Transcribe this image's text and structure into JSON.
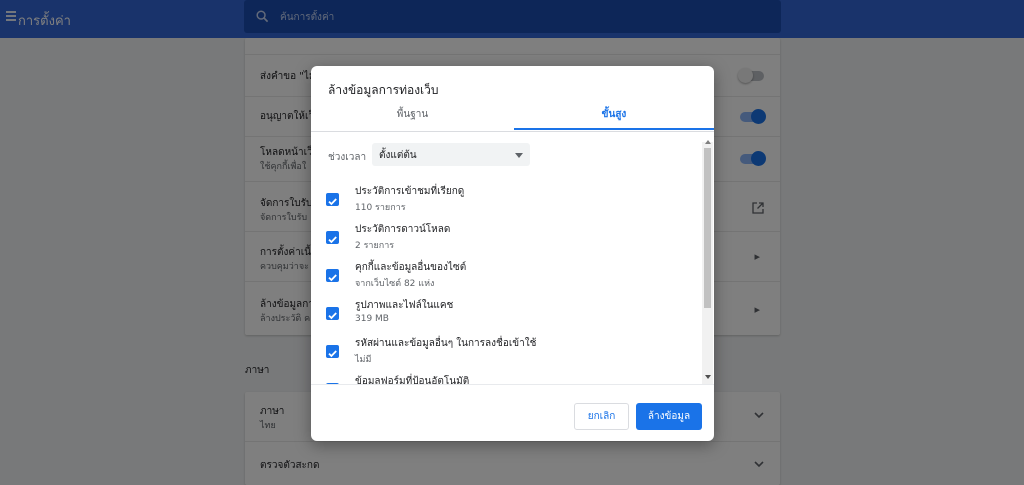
{
  "header": {
    "title": "การตั้งค่า",
    "search_placeholder": "ค้นการตั้งค่า"
  },
  "background": {
    "rows": [
      {
        "title": "ส่งคำขอ \"ไม่",
        "toggle": "off"
      },
      {
        "title": "อนุญาตให้เว็",
        "toggle": "on"
      },
      {
        "title": "โหลดหน้าเว็",
        "subtitle": "ใช้คุกกี้เพื่อใ",
        "toggle": "on"
      },
      {
        "title": "จัดการใบรับ",
        "subtitle": "จัดการใบรับ"
      },
      {
        "title": "การตั้งค่าเนื้",
        "subtitle": "ควบคุมว่าจะ"
      },
      {
        "title": "ล้างข้อมูลกา",
        "subtitle": "ล้างประวัติ ค"
      }
    ],
    "language_section": {
      "heading": "ภาษา",
      "rows": [
        {
          "title": "ภาษา",
          "subtitle": "ไทย"
        },
        {
          "title": "ตรวจตัวสะกด"
        }
      ]
    }
  },
  "dialog": {
    "title": "ล้างข้อมูลการท่องเว็บ",
    "tabs": {
      "basic": "พื้นฐาน",
      "advanced": "ขั้นสูง",
      "active": "advanced"
    },
    "time_range": {
      "label": "ช่วงเวลา",
      "value": "ตั้งแต่ต้น"
    },
    "items": [
      {
        "title": "ประวัติการเข้าชมที่เรียกดู",
        "subtitle": "110 รายการ",
        "checked": true
      },
      {
        "title": "ประวัติการดาวน์โหลด",
        "subtitle": "2 รายการ",
        "checked": true
      },
      {
        "title": "คุกกี้และข้อมูลอื่นของไซต์",
        "subtitle": "จากเว็บไซต์ 82 แห่ง",
        "checked": true
      },
      {
        "title": "รูปภาพและไฟล์ในแคช",
        "subtitle": "319 MB",
        "checked": true
      },
      {
        "title": "รหัสผ่านและข้อมูลอื่นๆ ในการลงชื่อเข้าใช้",
        "subtitle": "ไม่มี",
        "checked": true
      },
      {
        "title": "ข้อมูลฟอร์มที่ป้อนอัตโนมัติ",
        "subtitle": "",
        "checked": true
      }
    ],
    "buttons": {
      "cancel": "ยกเลิก",
      "clear": "ล้างข้อมูล"
    }
  },
  "colors": {
    "accent": "#1a73e8",
    "header": "#3367d6",
    "search_bg": "#1a4db0"
  }
}
